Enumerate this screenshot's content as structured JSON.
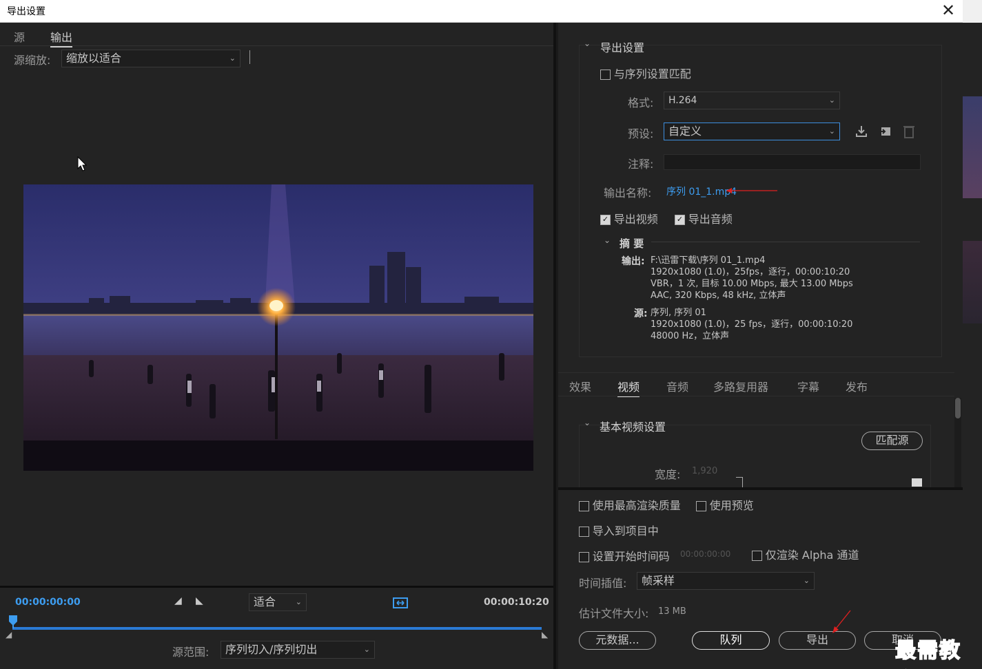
{
  "window": {
    "title": "导出设置",
    "close_glyph": "✕"
  },
  "left": {
    "tabs": [
      {
        "label": "源"
      },
      {
        "label": "输出"
      }
    ],
    "source_scale": {
      "label": "源缩放:",
      "value": "缩放以适合"
    },
    "playback": {
      "start_time": "00:00:00:00",
      "end_time": "00:00:10:20",
      "zoom": "适合",
      "source_range_label": "源范围:",
      "source_range_value": "序列切入/序列切出"
    }
  },
  "export_settings": {
    "heading": "导出设置",
    "match_sequence_label": "与序列设置匹配",
    "format_label": "格式:",
    "format_value": "H.264",
    "preset_label": "预设:",
    "preset_value": "自定义",
    "comment_label": "注释:",
    "comment_value": "",
    "output_name_label": "输出名称:",
    "output_name_value": "序列 01_1.mp4",
    "export_video_label": "导出视频",
    "export_audio_label": "导出音频",
    "summary": {
      "heading": "摘 要",
      "output_label": "输出:",
      "output_lines": [
        "F:\\迅雷下载\\序列 01_1.mp4",
        "1920x1080 (1.0)，25fps，逐行，00:00:10:20",
        "VBR，1 次, 目标 10.00 Mbps, 最大 13.00 Mbps",
        "AAC, 320 Kbps, 48  kHz, 立体声"
      ],
      "source_label": "源:",
      "source_lines": [
        "序列, 序列 01",
        "1920x1080 (1.0)，25 fps，逐行，00:00:10:20",
        "48000 Hz，立体声"
      ]
    }
  },
  "settings_tabs": [
    {
      "label": "效果"
    },
    {
      "label": "视频"
    },
    {
      "label": "音频"
    },
    {
      "label": "多路复用器"
    },
    {
      "label": "字幕"
    },
    {
      "label": "发布"
    }
  ],
  "video": {
    "section_heading": "基本视频设置",
    "match_source_button": "匹配源",
    "width_label": "宽度:",
    "width_value": "1,920"
  },
  "options": {
    "max_render_quality": "使用最高渲染质量",
    "use_previews": "使用预览",
    "import_into_project": "导入到项目中",
    "set_start_timecode": "设置开始时间码",
    "start_timecode_value": "00:00:00:00",
    "render_alpha_only": "仅渲染 Alpha 通道",
    "time_interpolation_label": "时间插值:",
    "time_interpolation_value": "帧采样",
    "estimated_size_label": "估计文件大小:",
    "estimated_size_value": "13 MB"
  },
  "buttons": {
    "metadata": "元数据...",
    "queue": "队列",
    "export": "导出",
    "cancel": "取消"
  },
  "watermark": "最需教育",
  "colors": {
    "accent_blue": "#2a7ad5",
    "link_blue": "#3d9df0",
    "annotation_red": "#e02020"
  }
}
